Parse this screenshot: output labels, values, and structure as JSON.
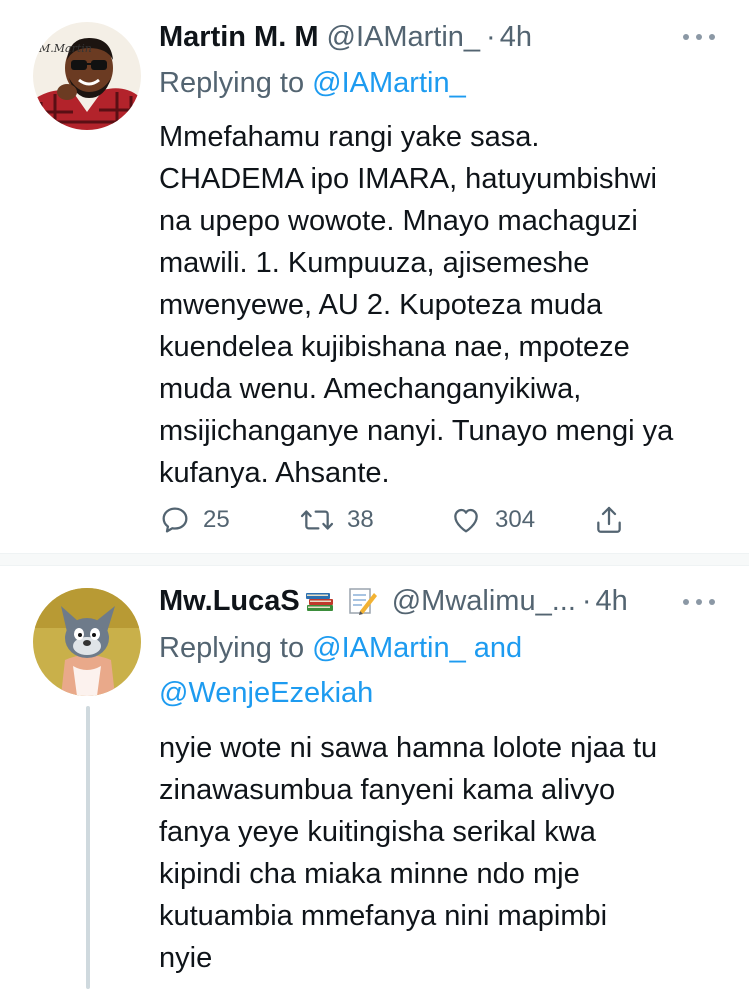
{
  "tweets": [
    {
      "author_name": "Martin M. M",
      "handle": "@IAMartin_",
      "separator": "·",
      "time": "4h",
      "replying_prefix": "Replying to",
      "replying_to": "@IAMartin_",
      "avatar_icon": "profile-avatar-cartoon-man",
      "avatar_signature": "M.Martin",
      "body_lines": [
        "Mmefahamu rangi yake sasa.",
        "CHADEMA ipo IMARA, hatuyumbishwi",
        "na upepo wowote. Mnayo machaguzi",
        "mawili. 1. Kumpuuza, ajisemeshe",
        "mwenyewe, AU  2. Kupoteza muda",
        "kuendelea kujibishana nae, mpoteze",
        "muda wenu. Amechanganyikiwa,",
        "msijichanganye nanyi. Tunayo mengi ya",
        "kufanya. Ahsante."
      ],
      "replies": "25",
      "retweets": "38",
      "likes": "304"
    },
    {
      "author_name": "Mw.LucaS",
      "emoji_icons": [
        "books-icon",
        "memo-icon"
      ],
      "handle": "@Mwalimu_...",
      "separator": "·",
      "time": "4h",
      "replying_prefix": "Replying to",
      "replying_to": "@IAMartin_",
      "replying_and": "and",
      "replying_to_2": "@WenjeEzekiah",
      "avatar_icon": "profile-avatar-cartoon-cat",
      "body_lines": [
        "nyie wote ni sawa hamna lolote njaa tu",
        "zinawasumbua fanyeni kama alivyo",
        "fanya yeye kuitingisha serikal kwa",
        "kipindi cha miaka minne ndo mje",
        "kutuambia mmefanya nini mapimbi",
        "nyie"
      ]
    }
  ],
  "colors": {
    "text": "#0f1419",
    "secondary": "#536471",
    "link": "#1d9bf0",
    "thread_line": "#cfd9de"
  }
}
